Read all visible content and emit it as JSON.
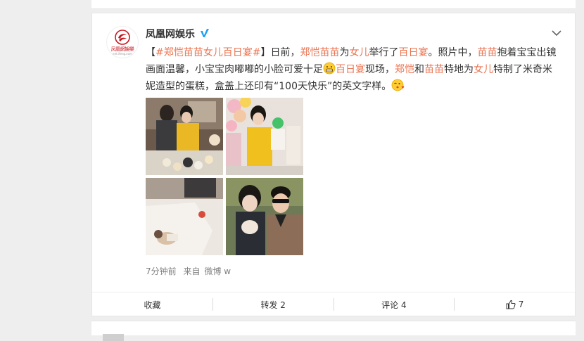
{
  "post": {
    "author": "凤凰网娱乐",
    "avatar": {
      "logo_text": "凤凰網娛樂",
      "logo_sub": "ent.ifeng.com"
    },
    "content": {
      "bracket_open": "【",
      "topic": "#郑恺苗苗女儿百日宴#",
      "bracket_close": "】",
      "t1": "日前，",
      "m1": "郑恺苗苗",
      "t2": "为",
      "m2": "女儿",
      "t3": "举行了",
      "m3": "百日宴",
      "t4": "。照片中，",
      "m4": "苗苗",
      "t5": "抱着宝宝出镜画面温馨，小宝宝肉嘟嘟的小脸可爱十足",
      "m5": "百日宴",
      "t6": "现场，",
      "m6": "郑恺",
      "t7": "和",
      "m7": "苗苗",
      "t8": "特地为",
      "m8": "女儿",
      "t9": "特制了米奇米妮造型的蛋糕，盒盖上还印有“100天快乐”的英文字样。"
    },
    "meta": {
      "time": "7分钟前",
      "source_prefix": "来自",
      "source": "微博 w"
    },
    "actions": {
      "favorite": "收藏",
      "repost": "转发 2",
      "comment": "评论 4",
      "like": "7"
    }
  },
  "colors": {
    "accent": "#eb7350",
    "verified": "#1da1f2",
    "brand_red": "#c8161d"
  },
  "icons": [
    "verified-icon",
    "chevron-down-icon",
    "grin-emoji-icon",
    "kiss-emoji-icon",
    "thumbs-up-icon"
  ]
}
